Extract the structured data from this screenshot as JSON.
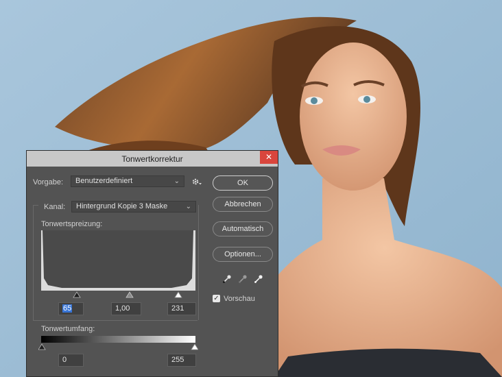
{
  "dialog": {
    "title": "Tonwertkorrektur",
    "close_glyph": "✕",
    "preset": {
      "label": "Vorgabe:",
      "value": "Benutzerdefiniert"
    },
    "channel": {
      "label": "Kanal:",
      "value": "Hintergrund Kopie 3 Maske"
    },
    "input_levels": {
      "label": "Tonwertspreizung:",
      "shadow": "65",
      "midtone": "1,00",
      "highlight": "231"
    },
    "output_levels": {
      "label": "Tonwertumfang:",
      "shadow": "0",
      "highlight": "255"
    },
    "buttons": {
      "ok": "OK",
      "cancel": "Abbrechen",
      "auto": "Automatisch",
      "options": "Optionen..."
    },
    "preview": {
      "label": "Vorschau",
      "checked": true
    },
    "icons": {
      "preset_menu": "gear-icon",
      "eyedroppers": [
        "black-eyedropper-icon",
        "gray-eyedropper-icon",
        "white-eyedropper-icon"
      ]
    },
    "colors": {
      "dialog_bg": "#535353",
      "titlebar_bg": "#c8c8c8",
      "close_bg": "#d9463d",
      "selection": "#3875d7"
    }
  }
}
